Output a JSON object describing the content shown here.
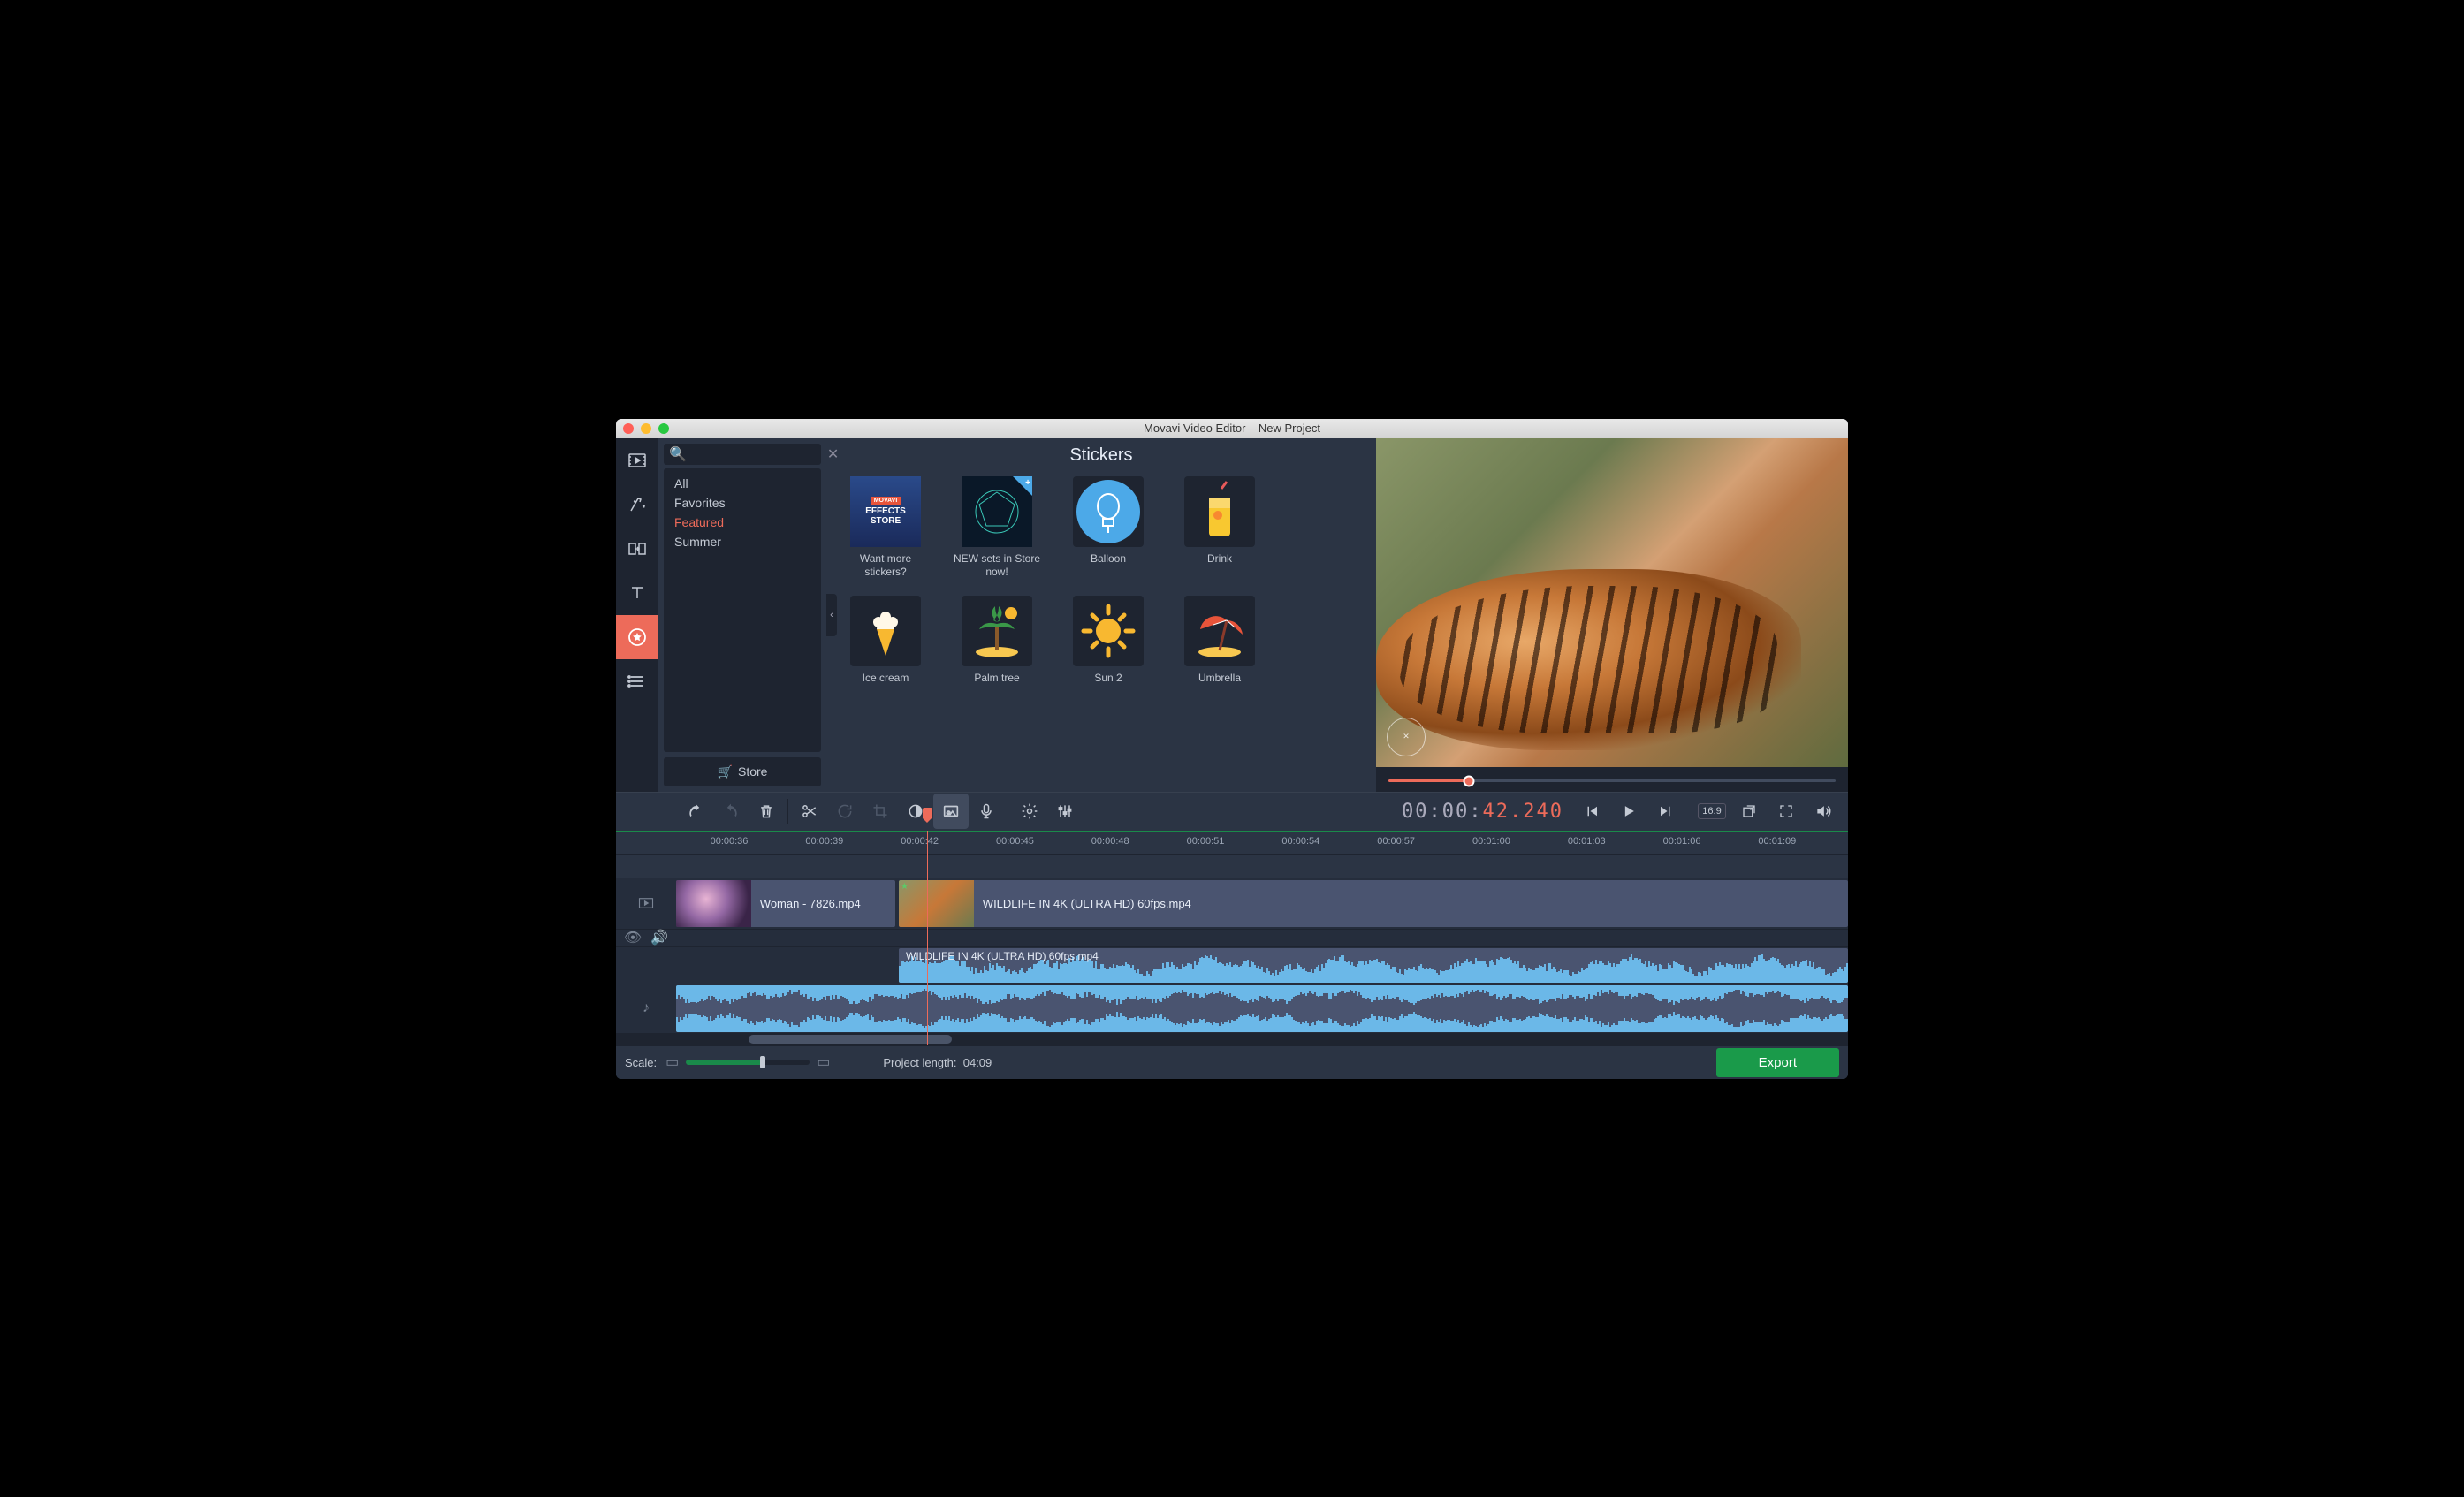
{
  "window": {
    "title": "Movavi Video Editor – New Project"
  },
  "categories": {
    "search_placeholder": "",
    "items": [
      "All",
      "Favorites",
      "Featured",
      "Summer"
    ],
    "selected_index": 2,
    "store_label": "Store"
  },
  "stickers": {
    "title": "Stickers",
    "items": [
      {
        "label": "Want more stickers?",
        "kind": "effects-store"
      },
      {
        "label": "NEW sets in Store now!",
        "kind": "new-sets",
        "badge": true
      },
      {
        "label": "Balloon",
        "kind": "balloon"
      },
      {
        "label": "Drink",
        "kind": "drink"
      },
      {
        "label": "Ice cream",
        "kind": "icecream"
      },
      {
        "label": "Palm tree",
        "kind": "palm"
      },
      {
        "label": "Sun 2",
        "kind": "sun"
      },
      {
        "label": "Umbrella",
        "kind": "umbrella"
      }
    ]
  },
  "preview": {
    "seek_percent": 18,
    "timecode_gray": "00:00:",
    "timecode_orange": "42.240",
    "aspect_label": "16:9"
  },
  "ruler": {
    "labels": [
      "00:00:36",
      "00:00:39",
      "00:00:42",
      "00:00:45",
      "00:00:48",
      "00:00:51",
      "00:00:54",
      "00:00:57",
      "00:01:00",
      "00:01:03",
      "00:01:06",
      "00:01:09"
    ]
  },
  "clips": {
    "video1": {
      "label": "Woman - 7826.mp4"
    },
    "video2": {
      "label": "WILDLIFE IN 4K (ULTRA HD) 60fps.mp4"
    },
    "audio1": {
      "label": "WILDLIFE IN 4K (ULTRA HD) 60fps.mp4"
    }
  },
  "bottom": {
    "scale_label": "Scale:",
    "project_length_label": "Project length:",
    "project_length_value": "04:09",
    "export_label": "Export"
  }
}
